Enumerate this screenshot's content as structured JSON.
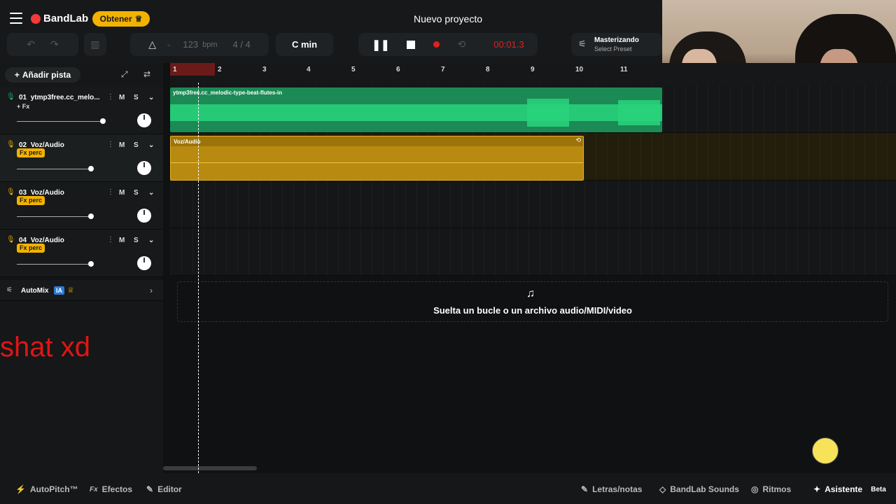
{
  "app": {
    "logo": "BandLab",
    "get_button": "Obtener",
    "project_title": "Nuevo proyecto"
  },
  "toolbar": {
    "bpm_value": "123",
    "bpm_unit": "bpm",
    "time_signature": "4 / 4",
    "key": "C min",
    "time_display": "00:01.3",
    "mastering_title": "Masterizando",
    "mastering_preset": "Select Preset"
  },
  "sidebar": {
    "add_track": "Añadir pista",
    "tracks": [
      {
        "number": "01",
        "name": "ytmp3free.cc_melo...",
        "fx": "+ Fx",
        "volume": 0.97
      },
      {
        "number": "02",
        "name": "Voz/Audio",
        "fx": "Fx perc",
        "volume": 0.8
      },
      {
        "number": "03",
        "name": "Voz/Audio",
        "fx": "Fx perc",
        "volume": 0.8
      },
      {
        "number": "04",
        "name": "Voz/Audio",
        "fx": "Fx perc",
        "volume": 0.8
      }
    ],
    "mute_label": "M",
    "solo_label": "S",
    "automix": "AutoMix",
    "automix_badge": "IA"
  },
  "overlay_text": "shat xd",
  "timeline": {
    "bars": [
      "1",
      "2",
      "3",
      "4",
      "5",
      "6",
      "7",
      "8",
      "9",
      "10",
      "11"
    ],
    "clip1_label": "ytmp3free.cc_melodic-type-beat-flutes-in",
    "clip2_label": "Voz/Audio",
    "drop_hint": "Suelta un bucle o un archivo audio/MIDI/video"
  },
  "bottombar": {
    "autopitch": "AutoPitch™",
    "effects": "Efectos",
    "editor": "Editor",
    "lyrics": "Letras/notas",
    "sounds": "BandLab Sounds",
    "rhythms": "Ritmos",
    "assistant": "Asistente",
    "beta": "Beta"
  },
  "colors": {
    "accent_yellow": "#f2b200",
    "green_clip": "#1b8a55",
    "red_time": "#e02020"
  }
}
